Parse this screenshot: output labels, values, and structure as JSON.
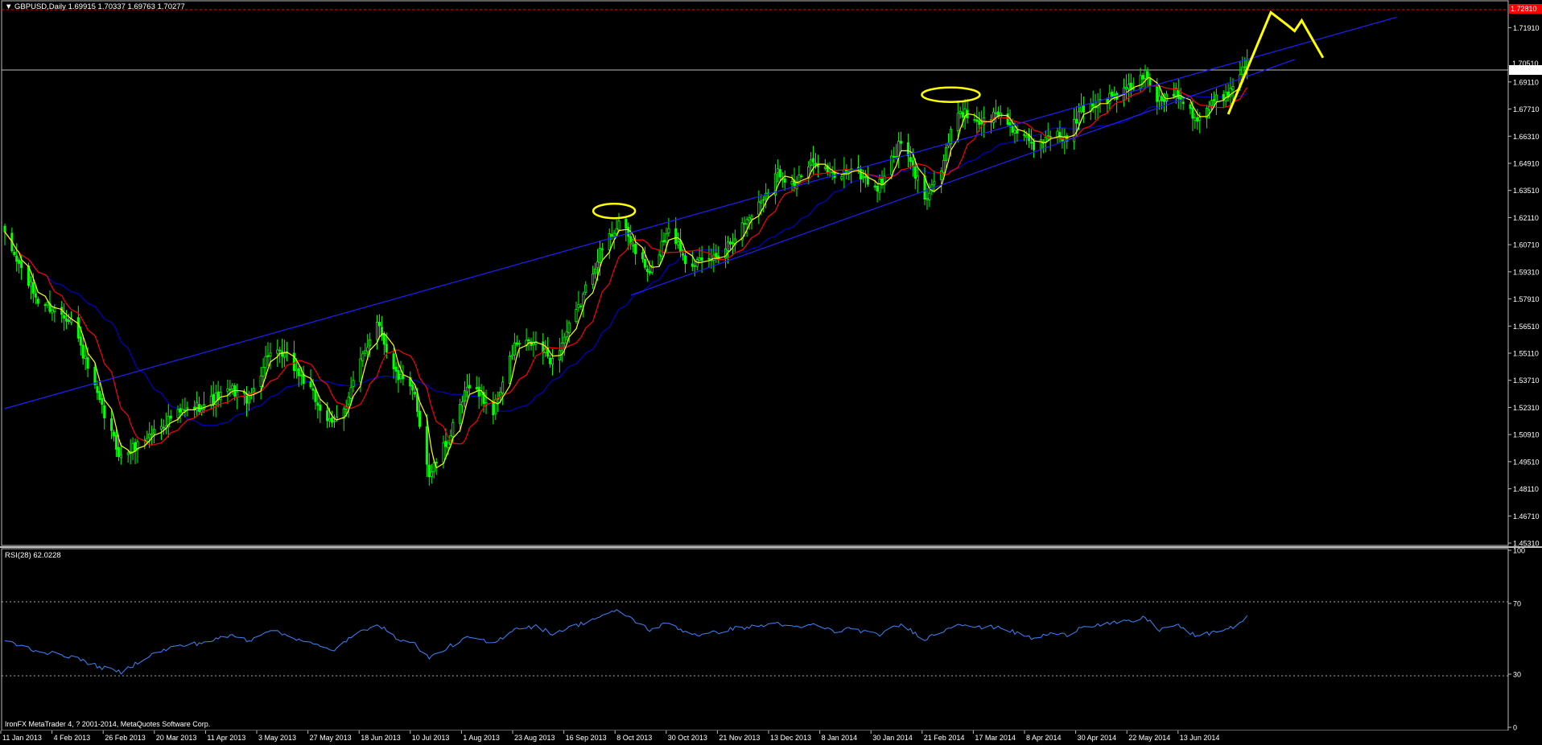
{
  "window": {
    "symbol_caption": "GBPUSD,Daily",
    "ohlc_caption": "1.69915 1.70337 1.69763 1.70277",
    "copyright": "IronFX MetaTrader 4, ? 2001-2014, MetaQuotes Software Corp."
  },
  "colors": {
    "background": "#000000",
    "candle_up": "#00ff00",
    "candle_down": "#00ff00",
    "ma_fast": "#ffff00",
    "ma_mid": "#ff0000",
    "ma_slow": "#0000cc",
    "channel": "#2020ff",
    "projection": "#ffff00",
    "rsi_line": "#3a86ff",
    "current_price_line": "#c0c0c0",
    "alert_line": "#ff0000",
    "alert_label_bg": "#ff0000",
    "axis_text": "#ffffff"
  },
  "price_axis": {
    "ylim": [
      1.4531,
      1.7284
    ],
    "ticks": [
      "1.71910",
      "1.69110",
      "1.67710",
      "1.66310",
      "1.64910",
      "1.63510",
      "1.62110",
      "1.60710",
      "1.59310",
      "1.57910",
      "1.56510",
      "1.55110",
      "1.53710",
      "1.52310",
      "1.50910",
      "1.49510",
      "1.48110",
      "1.46710",
      "1.45310"
    ],
    "current_label": "1.70277",
    "hidden_label": "1.70510",
    "alert_label": "1.72810",
    "current_price": 1.70277,
    "alert_price": 1.7281
  },
  "time_axis": {
    "labels": [
      "11 Jan 2013",
      "4 Feb 2013",
      "26 Feb 2013",
      "20 Mar 2013",
      "11 Apr 2013",
      "3 May 2013",
      "27 May 2013",
      "18 Jun 2013",
      "10 Jul 2013",
      "1 Aug 2013",
      "23 Aug 2013",
      "16 Sep 2013",
      "8 Oct 2013",
      "30 Oct 2013",
      "21 Nov 2013",
      "13 Dec 2013",
      "8 Jan 2014",
      "30 Jan 2014",
      "21 Feb 2014",
      "17 Mar 2014",
      "8 Apr 2014",
      "30 Apr 2014",
      "22 May 2014",
      "13 Jun 2014"
    ]
  },
  "rsi": {
    "caption": "RSI(28) 62.0228",
    "ticks": [
      "100",
      "70",
      "30",
      "0"
    ],
    "levels": [
      70,
      30
    ]
  },
  "chart_data": [
    {
      "type": "candlestick",
      "title": "GBPUSD,Daily",
      "period": "Daily",
      "x_range": [
        "2013-01-11",
        "2014-06-19"
      ],
      "ylim": [
        1.4531,
        1.7284
      ],
      "anchor_closes": [
        [
          "2013-01-11",
          1.611
        ],
        [
          "2013-01-25",
          1.578
        ],
        [
          "2013-02-08",
          1.569
        ],
        [
          "2013-02-20",
          1.525
        ],
        [
          "2013-03-01",
          1.497
        ],
        [
          "2013-03-12",
          1.508
        ],
        [
          "2013-03-22",
          1.518
        ],
        [
          "2013-04-05",
          1.525
        ],
        [
          "2013-04-17",
          1.532
        ],
        [
          "2013-04-24",
          1.527
        ],
        [
          "2013-05-02",
          1.551
        ],
        [
          "2013-05-10",
          1.549
        ],
        [
          "2013-05-17",
          1.537
        ],
        [
          "2013-05-29",
          1.513
        ],
        [
          "2013-06-04",
          1.526
        ],
        [
          "2013-06-17",
          1.569
        ],
        [
          "2013-06-24",
          1.542
        ],
        [
          "2013-07-03",
          1.529
        ],
        [
          "2013-07-09",
          1.488
        ],
        [
          "2013-07-18",
          1.509
        ],
        [
          "2013-07-26",
          1.536
        ],
        [
          "2013-08-05",
          1.521
        ],
        [
          "2013-08-14",
          1.555
        ],
        [
          "2013-08-23",
          1.556
        ],
        [
          "2013-08-30",
          1.547
        ],
        [
          "2013-09-10",
          1.574
        ],
        [
          "2013-09-18",
          1.601
        ],
        [
          "2013-09-27",
          1.619
        ],
        [
          "2013-10-04",
          1.604
        ],
        [
          "2013-10-10",
          1.591
        ],
        [
          "2013-10-18",
          1.617
        ],
        [
          "2013-10-25",
          1.6
        ],
        [
          "2013-11-01",
          1.597
        ],
        [
          "2013-11-08",
          1.602
        ],
        [
          "2013-11-15",
          1.612
        ],
        [
          "2013-11-25",
          1.628
        ],
        [
          "2013-12-03",
          1.645
        ],
        [
          "2013-12-10",
          1.638
        ],
        [
          "2013-12-19",
          1.651
        ],
        [
          "2013-12-27",
          1.641
        ],
        [
          "2014-01-03",
          1.647
        ],
        [
          "2014-01-14",
          1.636
        ],
        [
          "2014-01-24",
          1.66
        ],
        [
          "2014-02-03",
          1.632
        ],
        [
          "2014-02-10",
          1.646
        ],
        [
          "2014-02-17",
          1.677
        ],
        [
          "2014-02-27",
          1.67
        ],
        [
          "2014-03-06",
          1.675
        ],
        [
          "2014-03-14",
          1.665
        ],
        [
          "2014-03-21",
          1.657
        ],
        [
          "2014-03-28",
          1.665
        ],
        [
          "2014-04-04",
          1.661
        ],
        [
          "2014-04-10",
          1.677
        ],
        [
          "2014-04-17",
          1.681
        ],
        [
          "2014-04-25",
          1.684
        ],
        [
          "2014-05-02",
          1.689
        ],
        [
          "2014-05-07",
          1.695
        ],
        [
          "2014-05-13",
          1.681
        ],
        [
          "2014-05-20",
          1.687
        ],
        [
          "2014-05-29",
          1.672
        ],
        [
          "2014-06-05",
          1.681
        ],
        [
          "2014-06-12",
          1.687
        ],
        [
          "2014-06-19",
          1.70277
        ]
      ],
      "moving_averages": [
        {
          "name": "MA fast",
          "color": "#ffff00",
          "period": 5
        },
        {
          "name": "MA mid",
          "color": "#ff0000",
          "period": 13
        },
        {
          "name": "MA slow",
          "color": "#0000cc",
          "period": 34
        }
      ],
      "trend_lines": [
        {
          "name": "channel-upper",
          "points": [
            [
              "2013-01-11",
              1.5225
            ],
            [
              "2014-08-21",
              1.7245
            ]
          ]
        },
        {
          "name": "channel-lower",
          "points": [
            [
              "2013-10-02",
              1.581
            ],
            [
              "2014-07-09",
              1.7027
            ]
          ]
        }
      ],
      "projection_path": [
        [
          "2014-06-11",
          1.6744
        ],
        [
          "2014-06-29",
          1.727
        ],
        [
          "2014-07-06",
          1.7204
        ],
        [
          "2014-07-09",
          1.7174
        ],
        [
          "2014-07-12",
          1.7228
        ],
        [
          "2014-07-21",
          1.7036
        ]
      ],
      "highlight_ellipses": [
        {
          "center": [
            "2013-09-25",
            1.6245
          ]
        },
        {
          "center": [
            "2014-02-14",
            1.6845
          ]
        }
      ],
      "hlines": [
        {
          "name": "current-price",
          "y": 1.70277
        },
        {
          "name": "alert",
          "y": 1.7281
        }
      ]
    },
    {
      "type": "line",
      "title": "RSI(28) 62.0228",
      "ylim": [
        0,
        100
      ],
      "levels": [
        70,
        30
      ],
      "anchors": [
        [
          "2013-01-11",
          49
        ],
        [
          "2013-01-25",
          43
        ],
        [
          "2013-02-08",
          40
        ],
        [
          "2013-02-20",
          34
        ],
        [
          "2013-03-01",
          31
        ],
        [
          "2013-03-12",
          40
        ],
        [
          "2013-03-22",
          45
        ],
        [
          "2013-04-05",
          48
        ],
        [
          "2013-04-17",
          52
        ],
        [
          "2013-04-24",
          49
        ],
        [
          "2013-05-02",
          55
        ],
        [
          "2013-05-10",
          52
        ],
        [
          "2013-05-17",
          49
        ],
        [
          "2013-05-29",
          43
        ],
        [
          "2013-06-04",
          49
        ],
        [
          "2013-06-17",
          59
        ],
        [
          "2013-06-24",
          51
        ],
        [
          "2013-07-03",
          47
        ],
        [
          "2013-07-09",
          39
        ],
        [
          "2013-07-18",
          46
        ],
        [
          "2013-07-26",
          51
        ],
        [
          "2013-08-05",
          47
        ],
        [
          "2013-08-14",
          56
        ],
        [
          "2013-08-23",
          57
        ],
        [
          "2013-08-30",
          53
        ],
        [
          "2013-09-10",
          58
        ],
        [
          "2013-09-18",
          62
        ],
        [
          "2013-09-27",
          66
        ],
        [
          "2013-10-04",
          60
        ],
        [
          "2013-10-10",
          55
        ],
        [
          "2013-10-18",
          59
        ],
        [
          "2013-10-25",
          54
        ],
        [
          "2013-11-01",
          52
        ],
        [
          "2013-11-08",
          54
        ],
        [
          "2013-11-15",
          56
        ],
        [
          "2013-11-25",
          57
        ],
        [
          "2013-12-03",
          59
        ],
        [
          "2013-12-10",
          56
        ],
        [
          "2013-12-19",
          58
        ],
        [
          "2013-12-27",
          54
        ],
        [
          "2014-01-03",
          56
        ],
        [
          "2014-01-14",
          52
        ],
        [
          "2014-01-24",
          58
        ],
        [
          "2014-02-03",
          50
        ],
        [
          "2014-02-10",
          54
        ],
        [
          "2014-02-17",
          59
        ],
        [
          "2014-02-27",
          56
        ],
        [
          "2014-03-06",
          57
        ],
        [
          "2014-03-14",
          53
        ],
        [
          "2014-03-21",
          50
        ],
        [
          "2014-03-28",
          53
        ],
        [
          "2014-04-04",
          52
        ],
        [
          "2014-04-10",
          57
        ],
        [
          "2014-04-17",
          58
        ],
        [
          "2014-04-25",
          59
        ],
        [
          "2014-05-02",
          60
        ],
        [
          "2014-05-07",
          62
        ],
        [
          "2014-05-13",
          55
        ],
        [
          "2014-05-20",
          58
        ],
        [
          "2014-05-29",
          51
        ],
        [
          "2014-06-05",
          54
        ],
        [
          "2014-06-12",
          56
        ],
        [
          "2014-06-19",
          62.02
        ]
      ]
    }
  ]
}
